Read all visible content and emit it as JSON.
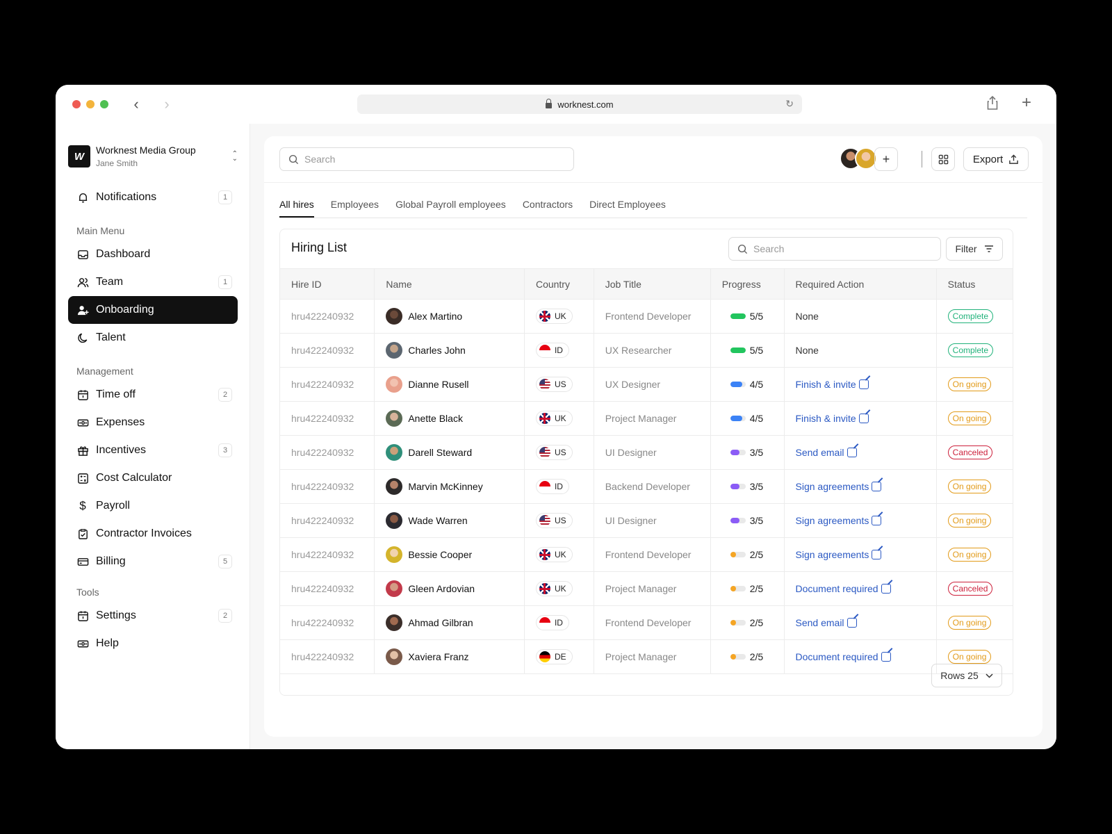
{
  "browser": {
    "url": "worknest.com"
  },
  "org": {
    "logo_text": "W",
    "name": "Worknest Media Group",
    "user": "Jane Smith"
  },
  "sidebar": {
    "notifications": {
      "label": "Notifications",
      "badge": "1"
    },
    "sections": {
      "main": "Main Menu",
      "management": "Management",
      "tools": "Tools"
    },
    "main_items": [
      {
        "label": "Dashboard",
        "badge": ""
      },
      {
        "label": "Team",
        "badge": "1"
      },
      {
        "label": "Onboarding",
        "badge": ""
      },
      {
        "label": "Talent",
        "badge": ""
      }
    ],
    "management_items": [
      {
        "label": "Time off",
        "badge": "2"
      },
      {
        "label": "Expenses",
        "badge": ""
      },
      {
        "label": "Incentives",
        "badge": "3"
      },
      {
        "label": "Cost Calculator",
        "badge": ""
      },
      {
        "label": "Payroll",
        "badge": ""
      },
      {
        "label": "Contractor Invoices",
        "badge": ""
      },
      {
        "label": "Billing",
        "badge": "5"
      }
    ],
    "tools_items": [
      {
        "label": "Settings",
        "badge": "2"
      },
      {
        "label": "Help",
        "badge": ""
      }
    ]
  },
  "header": {
    "search_placeholder": "Search",
    "export_label": "Export"
  },
  "tabs": [
    "All hires",
    "Employees",
    "Global Payroll employees",
    "Contractors",
    "Direct Employees"
  ],
  "hiring": {
    "title": "Hiring List",
    "search_placeholder": "Search",
    "filter_label": "Filter",
    "columns": [
      "Hire ID",
      "Name",
      "Country",
      "Job Title",
      "Progress",
      "Required Action",
      "Status"
    ],
    "rows": [
      {
        "id": "hru422240932",
        "name": "Alex Martino",
        "country": "UK",
        "job": "Frontend Developer",
        "progress": "5/5",
        "action": "None",
        "status": "Complete"
      },
      {
        "id": "hru422240932",
        "name": "Charles John",
        "country": "ID",
        "job": "UX Researcher",
        "progress": "5/5",
        "action": "None",
        "status": "Complete"
      },
      {
        "id": "hru422240932",
        "name": "Dianne Rusell",
        "country": "US",
        "job": "UX Designer",
        "progress": "4/5",
        "action": "Finish & invite",
        "status": "On going"
      },
      {
        "id": "hru422240932",
        "name": "Anette Black",
        "country": "UK",
        "job": "Project Manager",
        "progress": "4/5",
        "action": "Finish & invite",
        "status": "On going"
      },
      {
        "id": "hru422240932",
        "name": "Darell Steward",
        "country": "US",
        "job": "UI Designer",
        "progress": "3/5",
        "action": "Send email",
        "status": "Canceled"
      },
      {
        "id": "hru422240932",
        "name": "Marvin McKinney",
        "country": "ID",
        "job": "Backend Developer",
        "progress": "3/5",
        "action": "Sign agreements",
        "status": "On going"
      },
      {
        "id": "hru422240932",
        "name": "Wade Warren",
        "country": "US",
        "job": "UI Designer",
        "progress": "3/5",
        "action": "Sign agreements",
        "status": "On going"
      },
      {
        "id": "hru422240932",
        "name": "Bessie Cooper",
        "country": "UK",
        "job": "Frontend Developer",
        "progress": "2/5",
        "action": "Sign agreements",
        "status": "On going"
      },
      {
        "id": "hru422240932",
        "name": "Gleen Ardovian",
        "country": "UK",
        "job": "Project Manager",
        "progress": "2/5",
        "action": "Document required",
        "status": "Canceled"
      },
      {
        "id": "hru422240932",
        "name": "Ahmad Gilbran",
        "country": "ID",
        "job": "Frontend Developer",
        "progress": "2/5",
        "action": "Send email",
        "status": "On going"
      },
      {
        "id": "hru422240932",
        "name": "Xaviera Franz",
        "country": "DE",
        "job": "Project Manager",
        "progress": "2/5",
        "action": "Document required",
        "status": "On going"
      }
    ],
    "rows_label": "Rows 25"
  },
  "colors": {
    "accent_link": "#2b59c3",
    "complete": "#20b27a",
    "ongoing": "#e29a17",
    "canceled": "#cc1f3a",
    "progress_5": "#22c55e",
    "progress_4": "#3b82f6",
    "progress_3": "#8b5cf6",
    "progress_2": "#f5a524"
  }
}
